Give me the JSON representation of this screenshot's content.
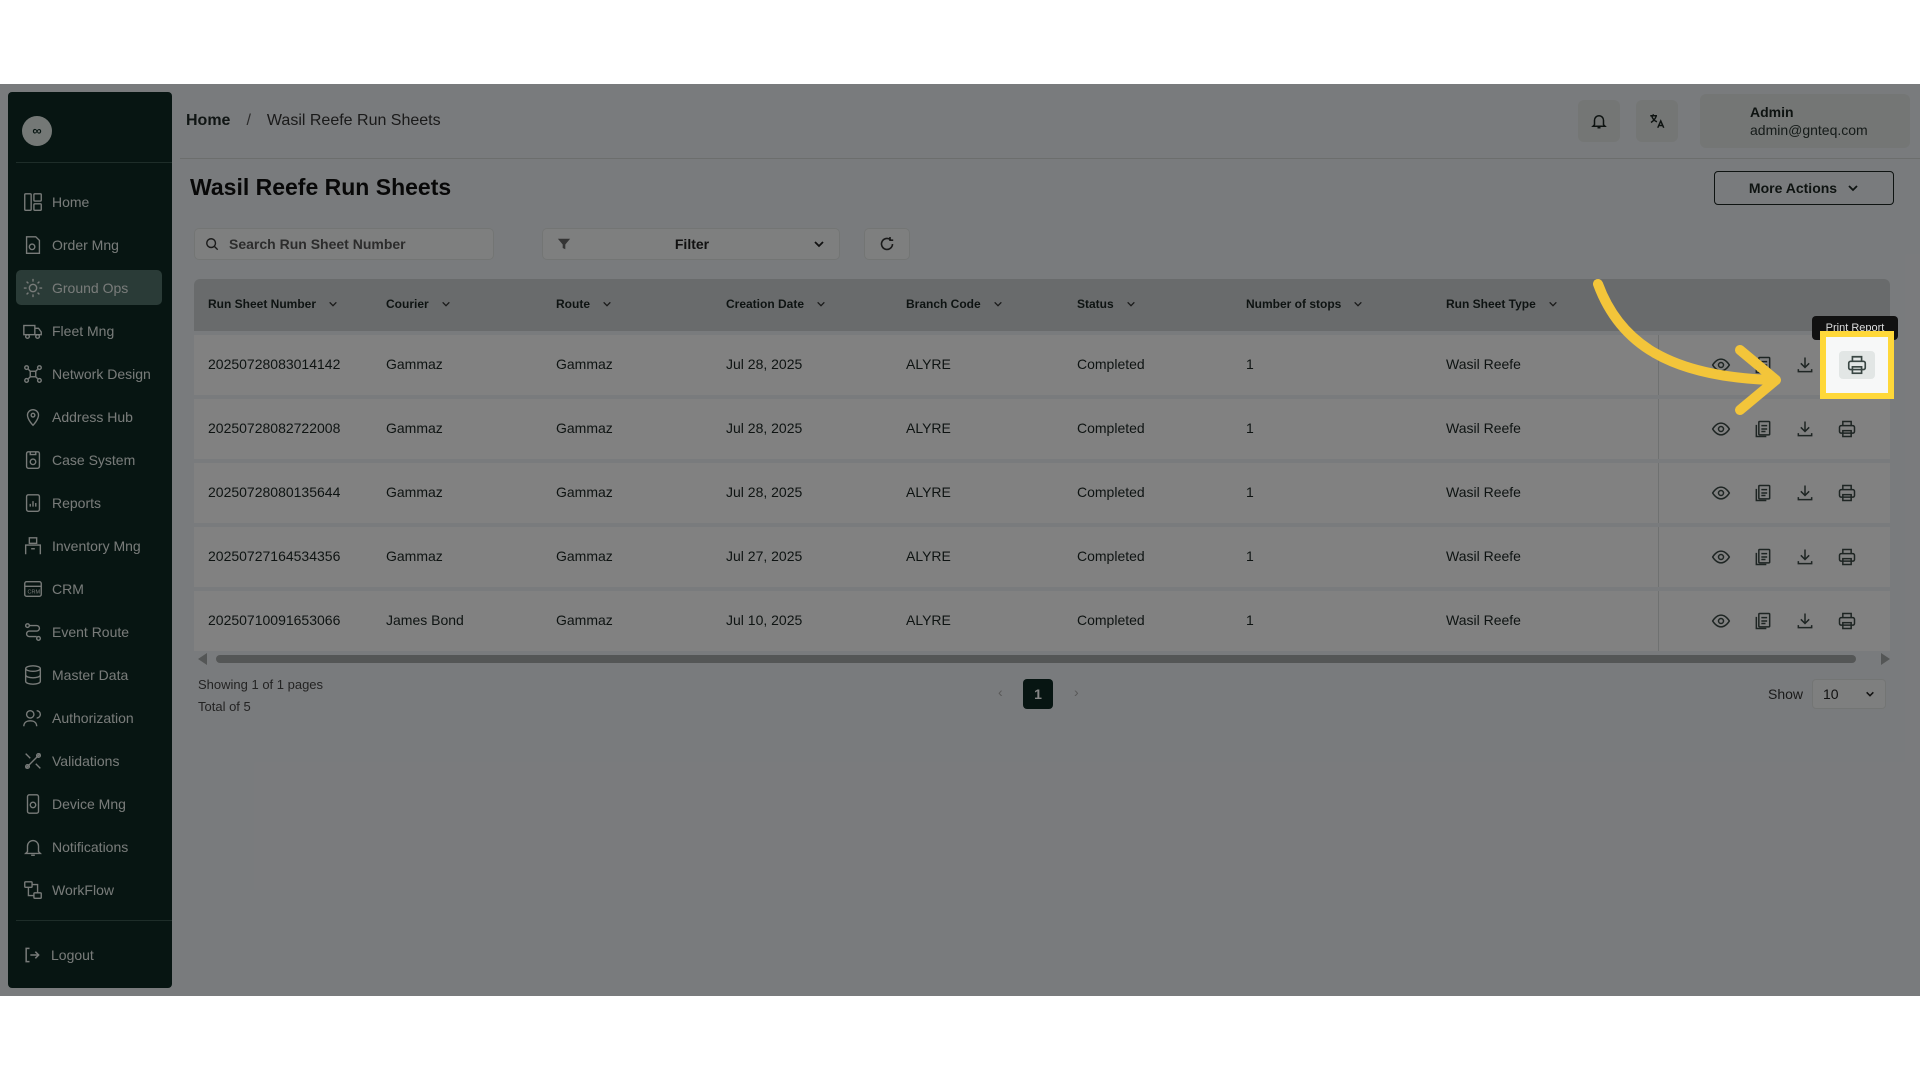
{
  "app": {
    "logo": "∞"
  },
  "sidebar": {
    "items": [
      {
        "label": "Home",
        "icon": "home-grid-icon"
      },
      {
        "label": "Order Mng",
        "icon": "order-icon"
      },
      {
        "label": "Ground Ops",
        "icon": "ground-ops-icon",
        "active": true
      },
      {
        "label": "Fleet Mng",
        "icon": "truck-icon"
      },
      {
        "label": "Network Design",
        "icon": "network-icon"
      },
      {
        "label": "Address Hub",
        "icon": "location-icon"
      },
      {
        "label": "Case System",
        "icon": "case-icon"
      },
      {
        "label": "Reports",
        "icon": "reports-icon"
      },
      {
        "label": "Inventory Mng",
        "icon": "inventory-icon"
      },
      {
        "label": "CRM",
        "icon": "crm-icon"
      },
      {
        "label": "Event Route",
        "icon": "route-icon"
      },
      {
        "label": "Master Data",
        "icon": "database-icon"
      },
      {
        "label": "Authorization",
        "icon": "users-icon"
      },
      {
        "label": "Validations",
        "icon": "validations-icon"
      },
      {
        "label": "Device Mng",
        "icon": "device-icon"
      },
      {
        "label": "Notifications",
        "icon": "bell-icon"
      },
      {
        "label": "WorkFlow",
        "icon": "workflow-icon"
      }
    ],
    "logout": "Logout"
  },
  "header": {
    "breadcrumb": {
      "home": "Home",
      "separator": "/",
      "current": "Wasil Reefe Run Sheets"
    },
    "user": {
      "name": "Admin",
      "email": "admin@gnteq.com"
    }
  },
  "page": {
    "title": "Wasil Reefe Run Sheets",
    "more_actions": "More Actions",
    "search_placeholder": "Search Run Sheet Number",
    "filter_label": "Filter"
  },
  "table": {
    "columns": [
      "Run Sheet Number",
      "Courier",
      "Route",
      "Creation Date",
      "Branch Code",
      "Status",
      "Number of stops",
      "Run Sheet Type"
    ],
    "rows": [
      [
        "20250728083014142",
        "Gammaz",
        "Gammaz",
        "Jul 28, 2025",
        "ALYRE",
        "Completed",
        "1",
        "Wasil Reefe"
      ],
      [
        "20250728082722008",
        "Gammaz",
        "Gammaz",
        "Jul 28, 2025",
        "ALYRE",
        "Completed",
        "1",
        "Wasil Reefe"
      ],
      [
        "20250728080135644",
        "Gammaz",
        "Gammaz",
        "Jul 28, 2025",
        "ALYRE",
        "Completed",
        "1",
        "Wasil Reefe"
      ],
      [
        "20250727164534356",
        "Gammaz",
        "Gammaz",
        "Jul 27, 2025",
        "ALYRE",
        "Completed",
        "1",
        "Wasil Reefe"
      ],
      [
        "20250710091653066",
        "James Bond",
        "Gammaz",
        "Jul 10, 2025",
        "ALYRE",
        "Completed",
        "1",
        "Wasil Reefe"
      ]
    ],
    "tooltip": "Print Report"
  },
  "pagination": {
    "showing": "Showing 1 of 1 pages",
    "total": "Total of 5",
    "current_page": "1",
    "show_label": "Show",
    "page_size": "10"
  },
  "colors": {
    "sidebar_bg": "#0f2a24",
    "highlight": "#ffd839",
    "arrow": "#f3c53a"
  }
}
